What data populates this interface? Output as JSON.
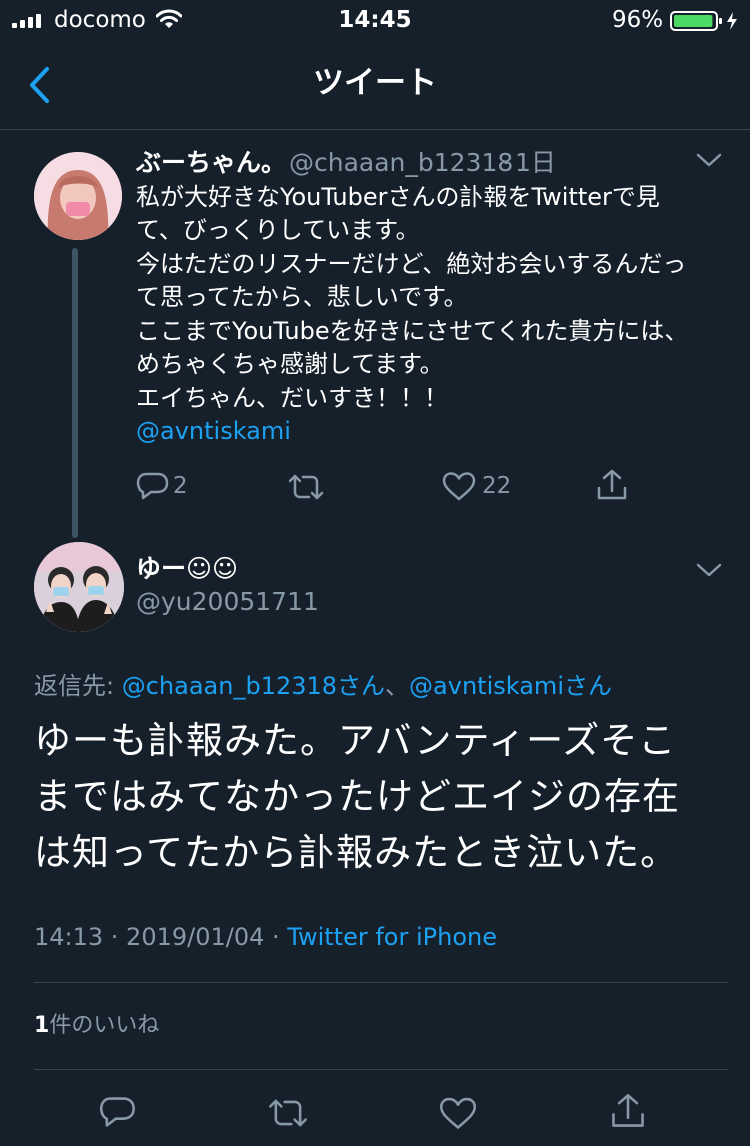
{
  "status_bar": {
    "carrier": "docomo",
    "time": "14:45",
    "battery_percent": "96%",
    "battery_level": 0.96,
    "battery_color": "#4cd964"
  },
  "nav": {
    "back_icon": "chevron-left-icon",
    "title": "ツイート"
  },
  "colors": {
    "background": "#15202b",
    "secondary_text": "#8899a6",
    "link": "#1da1f2",
    "divider": "#38444d"
  },
  "parent_tweet": {
    "name": "ぶーちゃん。",
    "handle": "@chaaan_b12318",
    "separator": "·",
    "time": "1日",
    "lines": [
      "私が大好きなYouTuberさんの訃報をTwitterで見",
      "て、びっくりしています。",
      "今はただのリスナーだけど、絶対お会いするんだっ",
      "て思ってたから、悲しいです。",
      "ここまでYouTubeを好きにさせてくれた貴方には、",
      "めちゃくちゃ感謝してます。",
      "エイちゃん、だいすき！！！"
    ],
    "mention": "@avntiskami",
    "reply_count": "2",
    "like_count": "22"
  },
  "main_tweet": {
    "name": "ゆー☺☺",
    "handle": "@yu20051711",
    "reply_label": "返信先: ",
    "reply_mention_1": "@chaaan_b12318さん",
    "reply_sep": "、",
    "reply_mention_2": "@avntiskamiさん",
    "lines": [
      "ゆーも訃報みた。アバンティーズそこ",
      "まではみてなかったけどエイジの存在",
      "は知ってたから訃報みたとき泣いた。"
    ],
    "timestamp": "14:13 · 2019/01/04 · ",
    "source": "Twitter for iPhone",
    "likes_count": "1",
    "likes_label": "件のいいね"
  }
}
